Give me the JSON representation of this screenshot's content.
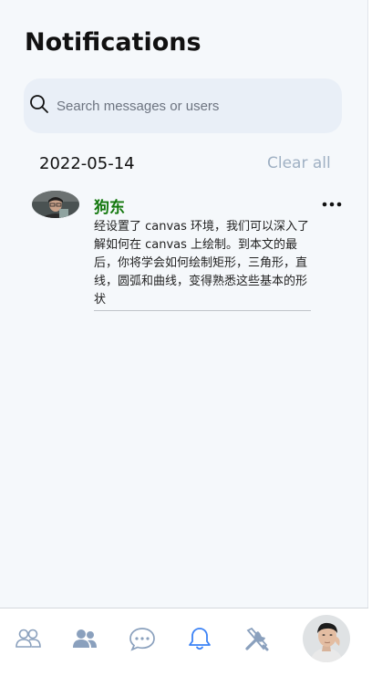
{
  "header": {
    "title": "Notifications"
  },
  "search": {
    "placeholder": "Search messages or users",
    "value": ""
  },
  "notifications": {
    "date": "2022-05-14",
    "clear_label": "Clear all",
    "items": [
      {
        "sender": "狗东",
        "message": "经设置了 canvas 环境，我们可以深入了解如何在 canvas 上绘制。到本文的最后，你将学会如何绘制矩形，三角形，直线，圆弧和曲线，变得熟悉这些基本的形状",
        "sender_color": "#14780e"
      }
    ]
  },
  "bottom_nav": {
    "items": [
      "contacts-icon",
      "groups-icon",
      "chat-icon",
      "bell-icon",
      "tools-icon",
      "profile-avatar"
    ],
    "active": "bell-icon",
    "icon_color": "#8aa0bd",
    "active_color": "#3b82f6"
  }
}
